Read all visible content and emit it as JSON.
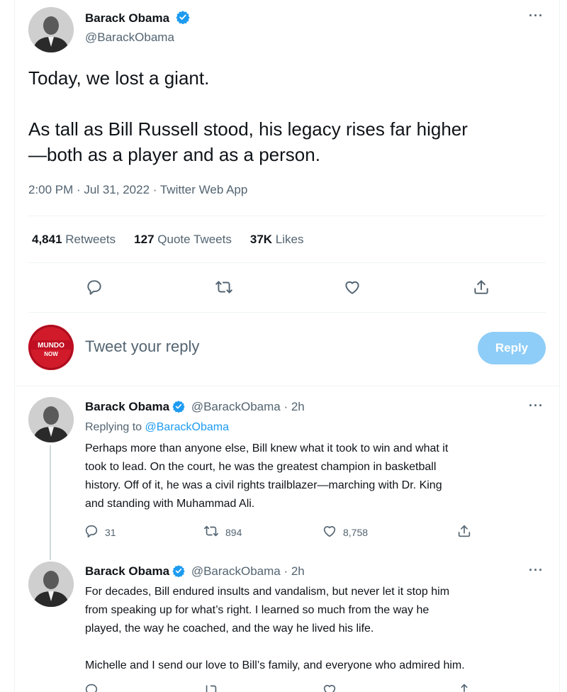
{
  "main_tweet": {
    "author_name": "Barack Obama",
    "author_handle": "@BarackObama",
    "text_para1": "Today, we lost a giant.",
    "text_para2_line1": "As tall as Bill Russell stood, his legacy rises far higher",
    "text_para2_line2": "—both as a player and as a person.",
    "meta": "2:00 PM · Jul 31, 2022 · Twitter Web App",
    "stats": {
      "retweets_count": "4,841",
      "retweets_label": "Retweets",
      "quotes_count": "127",
      "quotes_label": "Quote Tweets",
      "likes_count": "37K",
      "likes_label": "Likes"
    },
    "more": "···"
  },
  "composer": {
    "avatar_text_top": "MUNDO",
    "avatar_text_bottom": "NOW",
    "placeholder": "Tweet your reply",
    "button_label": "Reply"
  },
  "thread": [
    {
      "author_name": "Barack Obama",
      "author_handle": "@BarackObama",
      "time": "· 2h",
      "replying_prefix": "Replying to",
      "replying_handle": "@BarackObama",
      "line1": "Perhaps more than anyone else, Bill knew what it took to win and what it",
      "line2": "took to lead. On the court, he was the greatest champion in basketball",
      "line3": "history. Off of it, he was a civil rights trailblazer—marching with Dr. King",
      "line4": "and standing with Muhammad Ali.",
      "replies": "31",
      "retweets": "894",
      "likes": "8,758",
      "more": "···"
    },
    {
      "author_name": "Barack Obama",
      "author_handle": "@BarackObama",
      "time": "· 2h",
      "line1": "For decades, Bill endured insults and vandalism, but never let it stop him",
      "line2": "from speaking up for what’s right. I learned so much from the way he",
      "line3": "played, the way he coached, and the way he lived his life.",
      "line4": "Michelle and I send our love to Bill’s family, and everyone who admired him.",
      "more": "···"
    }
  ],
  "colors": {
    "accent": "#1d9bf0",
    "reply_button": "#8ecdf8",
    "secondary_text": "#536471",
    "divider": "#eff3f4"
  },
  "icons": [
    "verified-badge-icon",
    "more-icon",
    "reply-icon",
    "retweet-icon",
    "like-icon",
    "share-icon"
  ]
}
